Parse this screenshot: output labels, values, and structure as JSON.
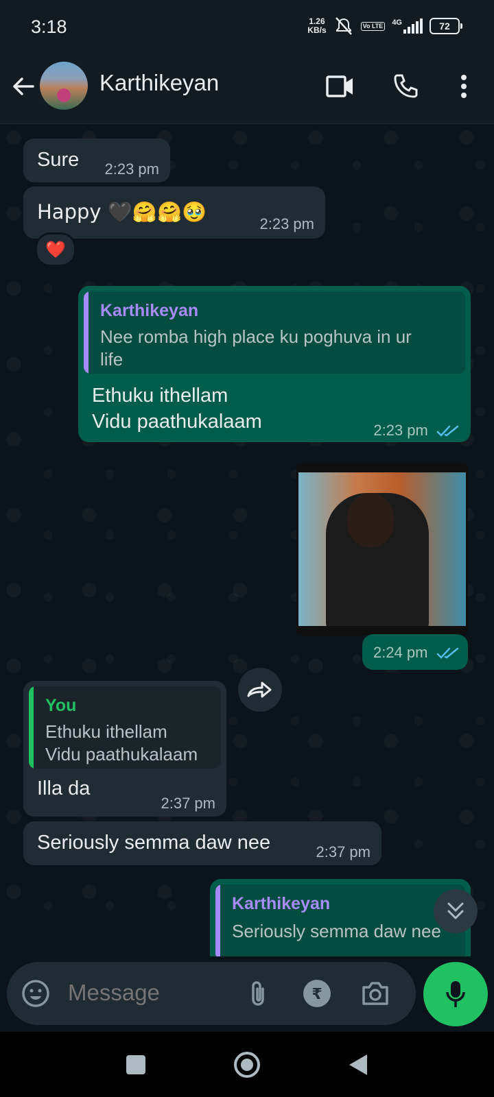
{
  "status": {
    "time": "3:18",
    "speed_value": "1.26",
    "speed_unit": "KB/s",
    "volte": "Vo LTE",
    "network": "4G",
    "battery": "72"
  },
  "header": {
    "contact_name": "Karthikeyan"
  },
  "messages": [
    {
      "text": "Sure",
      "time": "2:23 pm"
    },
    {
      "text": "Happy 🖤🤗🤗🥹",
      "time": "2:23 pm",
      "reaction": "❤️"
    },
    {
      "quote_name": "Karthikeyan",
      "quote_line1": "Nee romba high place ku poghuva in ur",
      "quote_line2": "life",
      "line1": "Ethuku ithellam",
      "line2": "Vidu paathukalaam",
      "time": "2:23 pm"
    },
    {
      "media": "video-thumbnail",
      "time": "2:24 pm"
    },
    {
      "quote_name": "You",
      "quote_line1": "Ethuku ithellam",
      "quote_line2": "Vidu paathukalaam",
      "text": "Illa da",
      "time": "2:37 pm"
    },
    {
      "text": "Seriously semma daw nee",
      "time": "2:37 pm"
    },
    {
      "quote_name": "Karthikeyan",
      "quote_line1": "Seriously semma daw nee"
    }
  ],
  "composer": {
    "placeholder": "Message"
  },
  "colors": {
    "incoming_bubble": "#202c33",
    "outgoing_bubble": "#005c4b",
    "accent_green": "#21c063",
    "quote_purple": "#a78bfa",
    "read_ticks": "#53bdeb"
  }
}
